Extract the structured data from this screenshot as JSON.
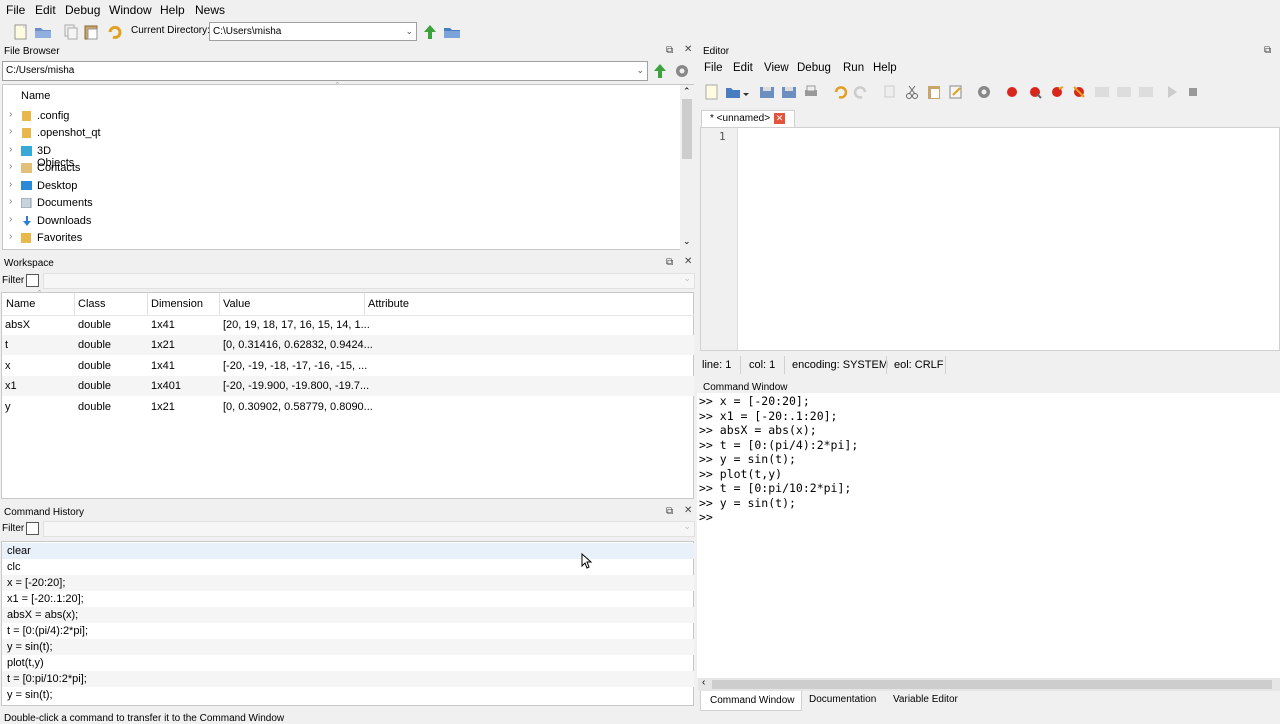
{
  "menu": [
    "File",
    "Edit",
    "Debug",
    "Window",
    "Help",
    "News"
  ],
  "toolbar": {
    "current_dir_label": "Current Directory:",
    "current_dir_value": "C:\\Users\\misha"
  },
  "file_browser": {
    "title": "File Browser",
    "path": "C:/Users/misha",
    "column": "Name",
    "items": [
      ".config",
      ".openshot_qt",
      "3D Objects",
      "Contacts",
      "Desktop",
      "Documents",
      "Downloads",
      "Favorites"
    ]
  },
  "workspace": {
    "title": "Workspace",
    "filter_label": "Filter",
    "columns": [
      "Name",
      "Class",
      "Dimension",
      "Value",
      "Attribute"
    ],
    "rows": [
      {
        "name": "absX",
        "class": "double",
        "dim": "1x41",
        "value": "[20, 19, 18, 17, 16, 15, 14, 1..."
      },
      {
        "name": "t",
        "class": "double",
        "dim": "1x21",
        "value": "[0, 0.31416, 0.62832, 0.9424..."
      },
      {
        "name": "x",
        "class": "double",
        "dim": "1x41",
        "value": "[-20, -19, -18, -17, -16, -15, ..."
      },
      {
        "name": "x1",
        "class": "double",
        "dim": "1x401",
        "value": "[-20, -19.900, -19.800, -19.7..."
      },
      {
        "name": "y",
        "class": "double",
        "dim": "1x21",
        "value": "[0, 0.30902, 0.58779, 0.8090..."
      }
    ]
  },
  "history": {
    "title": "Command History",
    "filter_label": "Filter",
    "items": [
      "clear",
      "clc",
      "x = [-20:20];",
      "x1 = [-20:.1:20];",
      "absX = abs(x);",
      "t = [0:(pi/4):2*pi];",
      "y = sin(t);",
      "plot(t,y)",
      "t = [0:pi/10:2*pi];",
      "y = sin(t);"
    ],
    "status": "Double-click a command to transfer it to the Command Window"
  },
  "editor": {
    "title": "Editor",
    "menu": [
      "File",
      "Edit",
      "View",
      "Debug",
      "Run",
      "Help"
    ],
    "tab": "* <unnamed>",
    "line_number": "1",
    "status": {
      "line": "line: 1",
      "col": "col: 1",
      "encoding": "encoding: SYSTEM",
      "eol": "eol: CRLF"
    }
  },
  "command_window": {
    "title": "Command Window",
    "lines": [
      ">> x = [-20:20];",
      ">> x1 = [-20:.1:20];",
      ">> absX = abs(x);",
      ">> t = [0:(pi/4):2*pi];",
      ">> y = sin(t);",
      ">> plot(t,y)",
      ">> t = [0:pi/10:2*pi];",
      ">> y = sin(t);",
      ">>"
    ]
  },
  "bottom_tabs": [
    "Command Window",
    "Documentation",
    "Variable Editor"
  ],
  "colors": {
    "accent": "#316ac5",
    "folder": "#e8b84a",
    "record": "#d9261c",
    "green": "#3ca23c"
  }
}
